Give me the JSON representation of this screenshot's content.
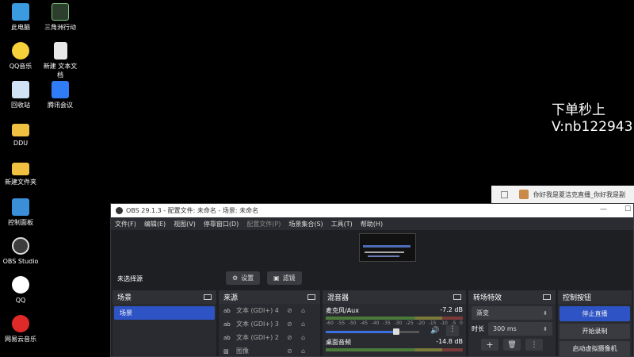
{
  "desktop": {
    "icons": [
      {
        "label": "此电脑",
        "icon": "computer-icon",
        "color": "#3a9be0"
      },
      {
        "label": "三角洲行动",
        "icon": "game-icon",
        "color": "#2c3e2c"
      },
      {
        "label": "QQ音乐",
        "icon": "music-icon",
        "color": "#f7d13a"
      },
      {
        "label": "新建 文本文",
        "label2": "档",
        "icon": "text-file-icon",
        "color": "#e8e8e8"
      },
      {
        "label": "回收站",
        "icon": "recycle-bin-icon",
        "color": "#cfe3f5"
      },
      {
        "label": "腾讯会议",
        "icon": "meeting-icon",
        "color": "#2f7cf6"
      },
      {
        "label": "DDU",
        "icon": "folder-icon",
        "color": "#f0c040"
      },
      {
        "label": "新建文件夹",
        "icon": "folder-icon",
        "color": "#f0c040"
      },
      {
        "label": "控制面板",
        "icon": "control-panel-icon",
        "color": "#3a8fd8"
      },
      {
        "label": "OBS Studio",
        "icon": "obs-icon",
        "color": "#3c3c3c"
      },
      {
        "label": "QQ",
        "icon": "qq-icon",
        "color": "#ffffff"
      },
      {
        "label": "网易云音乐",
        "icon": "netease-music-icon",
        "color": "#e02a2a"
      }
    ],
    "overlay_line1": "下单秒上",
    "overlay_line2": "V:nb122943"
  },
  "notification": {
    "message": "你好我是夏洁克直播_你好我是副"
  },
  "obs": {
    "title": "OBS 29.1.3 - 配置文件: 未命名 - 场景: 未命名",
    "menu": [
      "文件(F)",
      "编辑(E)",
      "视图(V)",
      "停靠窗口(D)",
      "配置文件(P)",
      "场景集合(S)",
      "工具(T)",
      "帮助(H)"
    ],
    "source_status": "未选择源",
    "settings_label": "设置",
    "filters_label": "滤镜",
    "docks": {
      "scenes": {
        "title": "场景",
        "items": [
          "场景"
        ]
      },
      "sources": {
        "title": "来源",
        "items": [
          {
            "type": "ab",
            "label": "文本 (GDI+) 4"
          },
          {
            "type": "ab",
            "label": "文本 (GDI+) 3"
          },
          {
            "type": "ab",
            "label": "文本 (GDI+) 2"
          },
          {
            "type": "img",
            "label": "图像"
          }
        ]
      },
      "mixer": {
        "title": "混音器",
        "channels": [
          {
            "name": "麦克风/Aux",
            "db": "-7.2 dB",
            "volume": 0.75
          },
          {
            "name": "桌面音频",
            "db": "-14.8 dB"
          }
        ],
        "scale": [
          "-60",
          "-55",
          "-50",
          "-45",
          "-40",
          "-35",
          "-30",
          "-25",
          "-20",
          "-15",
          "-10",
          "-5",
          "0"
        ]
      },
      "transitions": {
        "title": "转场特效",
        "selected": "渐变",
        "duration_label": "时长",
        "duration_value": "300 ms"
      },
      "controls": {
        "title": "控制按钮",
        "stop_stream": "停止直播",
        "start_record": "开始录制",
        "start_virtualcam": "启动虚拟摄像机"
      }
    }
  }
}
